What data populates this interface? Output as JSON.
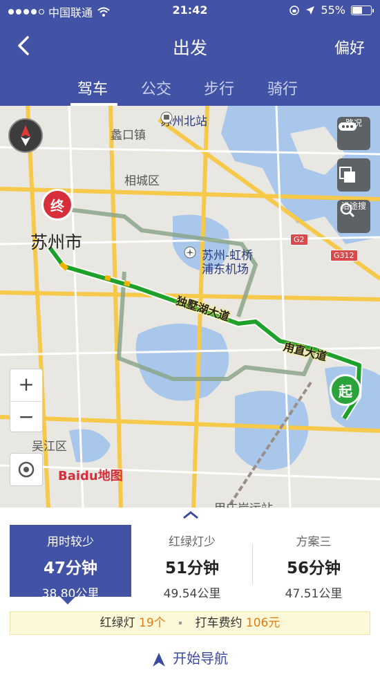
{
  "status_bar": {
    "carrier": "中国联通",
    "time": "21:42",
    "battery": "55%",
    "battery_level": 0.55
  },
  "header": {
    "title": "出发",
    "preference": "偏好",
    "tabs": [
      "驾车",
      "公交",
      "步行",
      "骑行"
    ],
    "active_tab": 0
  },
  "map": {
    "labels": {
      "north_station": "苏州北站",
      "lukou": "蠡口镇",
      "xiangcheng": "相城区",
      "suzhou_city": "苏州市",
      "airport_line1": "苏州-虹桥",
      "airport_line2": "浦东机场",
      "wujiang": "吴江区",
      "bottom_partial": "甲庄岸运站"
    },
    "roads": {
      "dushu_lake": "独墅湖大道",
      "yongzhi": "甪直大道"
    },
    "shields": {
      "g2": "G2",
      "g312": "G312"
    },
    "buttons": {
      "traffic": "路况",
      "search_along": "沿途搜"
    },
    "zoom_in": "+",
    "zoom_out": "−",
    "start_pin": "起",
    "end_pin": "终",
    "logo": "Baidu地图"
  },
  "plans": [
    {
      "tag": "用时较少",
      "time": "47分钟",
      "distance": "38.80公里"
    },
    {
      "tag": "红绿灯少",
      "time": "51分钟",
      "distance": "49.54公里"
    },
    {
      "tag": "方案三",
      "time": "56分钟",
      "distance": "47.51公里"
    }
  ],
  "info": {
    "lights_label": "红绿灯",
    "lights_value": "19个",
    "fare_label": "打车费约",
    "fare_value": "106元"
  },
  "start_navigation": "开始导航",
  "colors": {
    "brand": "#4253a6",
    "route_primary": "#1ea12a",
    "route_alt": "#a9b7a3",
    "highlight": "#e27b12"
  }
}
